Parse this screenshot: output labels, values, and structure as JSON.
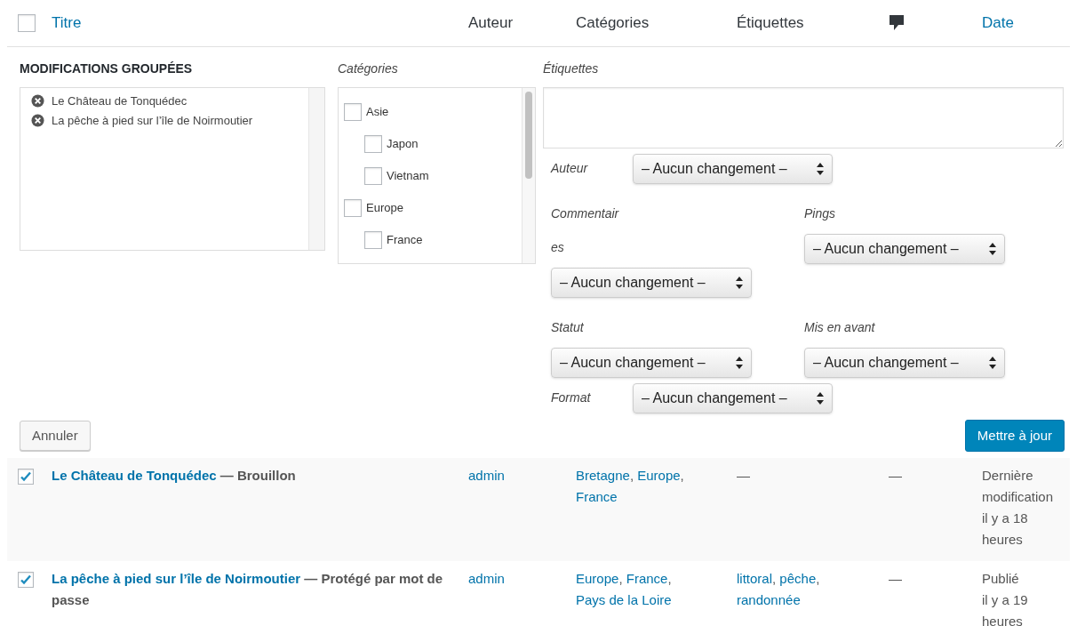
{
  "header": {
    "select_all": {
      "checked": false
    },
    "columns": [
      {
        "kind": "link",
        "label": "Titre"
      },
      {
        "kind": "text",
        "label": "Auteur"
      },
      {
        "kind": "text",
        "label": "Catégories"
      },
      {
        "kind": "text",
        "label": "Étiquettes"
      },
      {
        "kind": "comment_icon"
      },
      {
        "kind": "link",
        "label": "Date"
      }
    ]
  },
  "bulk_edit": {
    "title": "MODIFICATIONS GROUPÉES",
    "posts": [
      "Le Château de Tonquédec",
      "La pêche à pied sur l’île de Noirmoutier"
    ],
    "categories_label": "Catégories",
    "categories": [
      {
        "label": "Asie",
        "checked": false,
        "children": [
          {
            "label": "Japon",
            "checked": false
          },
          {
            "label": "Vietnam",
            "checked": false
          }
        ]
      },
      {
        "label": "Europe",
        "checked": false,
        "children": [
          {
            "label": "France",
            "checked": false
          }
        ]
      }
    ],
    "tags_label": "Étiquettes",
    "fields": [
      {
        "kind": "inline",
        "label": "Auteur",
        "value": "– Aucun changement –"
      },
      {
        "kind": "pair",
        "left": {
          "label": "Commentaires",
          "value": "– Aucun changement –"
        },
        "right": {
          "label": "Pings",
          "value": "– Aucun changement –"
        }
      },
      {
        "kind": "pair",
        "left": {
          "label": "Statut",
          "value": "– Aucun changement –"
        },
        "right": {
          "label": "Mis en avant",
          "value": "– Aucun changement –"
        }
      },
      {
        "kind": "inline",
        "label": "Format",
        "value": "– Aucun changement –"
      }
    ],
    "cancel": "Annuler",
    "update": "Mettre à jour"
  },
  "rows": [
    {
      "checked": true,
      "title": "Le Château de Tonquédec",
      "state": "— Brouillon",
      "author": "admin",
      "categories": [
        {
          "text": "Bretagne",
          "suffix": ","
        },
        {
          "text": "Europe",
          "suffix": ","
        },
        {
          "text": "France"
        }
      ],
      "tags": [],
      "tags_empty": "—",
      "comments": "—",
      "date": [
        "Dernière modification",
        "il y a 18 heures"
      ]
    },
    {
      "checked": true,
      "title": "La pêche à pied sur l’île de Noirmoutier",
      "state": "— Protégé par mot de passe",
      "author": "admin",
      "categories": [
        {
          "text": "Europe",
          "suffix": ","
        },
        {
          "text": "France",
          "suffix": ","
        },
        {
          "text": "Pays de la Loire"
        }
      ],
      "tags": [
        {
          "text": "littoral",
          "suffix": ","
        },
        {
          "text": "pêche",
          "suffix": ","
        },
        {
          "text": "randonnée"
        }
      ],
      "comments": "—",
      "date": [
        "Publié",
        "il y a 19 heures"
      ]
    }
  ]
}
